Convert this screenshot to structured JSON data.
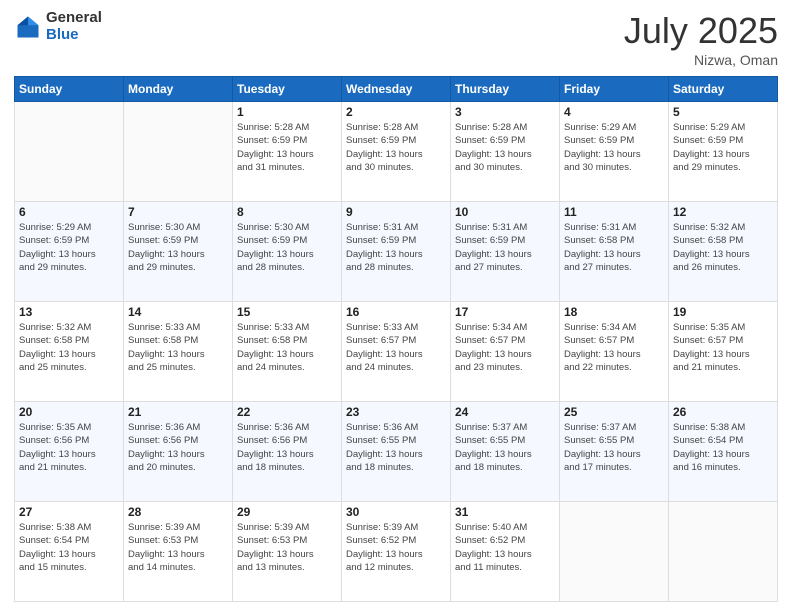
{
  "logo": {
    "text_general": "General",
    "text_blue": "Blue"
  },
  "header": {
    "month": "July 2025",
    "location": "Nizwa, Oman"
  },
  "weekdays": [
    "Sunday",
    "Monday",
    "Tuesday",
    "Wednesday",
    "Thursday",
    "Friday",
    "Saturday"
  ],
  "weeks": [
    [
      {
        "day": "",
        "info": ""
      },
      {
        "day": "",
        "info": ""
      },
      {
        "day": "1",
        "info": "Sunrise: 5:28 AM\nSunset: 6:59 PM\nDaylight: 13 hours\nand 31 minutes."
      },
      {
        "day": "2",
        "info": "Sunrise: 5:28 AM\nSunset: 6:59 PM\nDaylight: 13 hours\nand 30 minutes."
      },
      {
        "day": "3",
        "info": "Sunrise: 5:28 AM\nSunset: 6:59 PM\nDaylight: 13 hours\nand 30 minutes."
      },
      {
        "day": "4",
        "info": "Sunrise: 5:29 AM\nSunset: 6:59 PM\nDaylight: 13 hours\nand 30 minutes."
      },
      {
        "day": "5",
        "info": "Sunrise: 5:29 AM\nSunset: 6:59 PM\nDaylight: 13 hours\nand 29 minutes."
      }
    ],
    [
      {
        "day": "6",
        "info": "Sunrise: 5:29 AM\nSunset: 6:59 PM\nDaylight: 13 hours\nand 29 minutes."
      },
      {
        "day": "7",
        "info": "Sunrise: 5:30 AM\nSunset: 6:59 PM\nDaylight: 13 hours\nand 29 minutes."
      },
      {
        "day": "8",
        "info": "Sunrise: 5:30 AM\nSunset: 6:59 PM\nDaylight: 13 hours\nand 28 minutes."
      },
      {
        "day": "9",
        "info": "Sunrise: 5:31 AM\nSunset: 6:59 PM\nDaylight: 13 hours\nand 28 minutes."
      },
      {
        "day": "10",
        "info": "Sunrise: 5:31 AM\nSunset: 6:59 PM\nDaylight: 13 hours\nand 27 minutes."
      },
      {
        "day": "11",
        "info": "Sunrise: 5:31 AM\nSunset: 6:58 PM\nDaylight: 13 hours\nand 27 minutes."
      },
      {
        "day": "12",
        "info": "Sunrise: 5:32 AM\nSunset: 6:58 PM\nDaylight: 13 hours\nand 26 minutes."
      }
    ],
    [
      {
        "day": "13",
        "info": "Sunrise: 5:32 AM\nSunset: 6:58 PM\nDaylight: 13 hours\nand 25 minutes."
      },
      {
        "day": "14",
        "info": "Sunrise: 5:33 AM\nSunset: 6:58 PM\nDaylight: 13 hours\nand 25 minutes."
      },
      {
        "day": "15",
        "info": "Sunrise: 5:33 AM\nSunset: 6:58 PM\nDaylight: 13 hours\nand 24 minutes."
      },
      {
        "day": "16",
        "info": "Sunrise: 5:33 AM\nSunset: 6:57 PM\nDaylight: 13 hours\nand 24 minutes."
      },
      {
        "day": "17",
        "info": "Sunrise: 5:34 AM\nSunset: 6:57 PM\nDaylight: 13 hours\nand 23 minutes."
      },
      {
        "day": "18",
        "info": "Sunrise: 5:34 AM\nSunset: 6:57 PM\nDaylight: 13 hours\nand 22 minutes."
      },
      {
        "day": "19",
        "info": "Sunrise: 5:35 AM\nSunset: 6:57 PM\nDaylight: 13 hours\nand 21 minutes."
      }
    ],
    [
      {
        "day": "20",
        "info": "Sunrise: 5:35 AM\nSunset: 6:56 PM\nDaylight: 13 hours\nand 21 minutes."
      },
      {
        "day": "21",
        "info": "Sunrise: 5:36 AM\nSunset: 6:56 PM\nDaylight: 13 hours\nand 20 minutes."
      },
      {
        "day": "22",
        "info": "Sunrise: 5:36 AM\nSunset: 6:56 PM\nDaylight: 13 hours\nand 18 minutes."
      },
      {
        "day": "23",
        "info": "Sunrise: 5:36 AM\nSunset: 6:55 PM\nDaylight: 13 hours\nand 18 minutes."
      },
      {
        "day": "24",
        "info": "Sunrise: 5:37 AM\nSunset: 6:55 PM\nDaylight: 13 hours\nand 18 minutes."
      },
      {
        "day": "25",
        "info": "Sunrise: 5:37 AM\nSunset: 6:55 PM\nDaylight: 13 hours\nand 17 minutes."
      },
      {
        "day": "26",
        "info": "Sunrise: 5:38 AM\nSunset: 6:54 PM\nDaylight: 13 hours\nand 16 minutes."
      }
    ],
    [
      {
        "day": "27",
        "info": "Sunrise: 5:38 AM\nSunset: 6:54 PM\nDaylight: 13 hours\nand 15 minutes."
      },
      {
        "day": "28",
        "info": "Sunrise: 5:39 AM\nSunset: 6:53 PM\nDaylight: 13 hours\nand 14 minutes."
      },
      {
        "day": "29",
        "info": "Sunrise: 5:39 AM\nSunset: 6:53 PM\nDaylight: 13 hours\nand 13 minutes."
      },
      {
        "day": "30",
        "info": "Sunrise: 5:39 AM\nSunset: 6:52 PM\nDaylight: 13 hours\nand 12 minutes."
      },
      {
        "day": "31",
        "info": "Sunrise: 5:40 AM\nSunset: 6:52 PM\nDaylight: 13 hours\nand 11 minutes."
      },
      {
        "day": "",
        "info": ""
      },
      {
        "day": "",
        "info": ""
      }
    ]
  ]
}
